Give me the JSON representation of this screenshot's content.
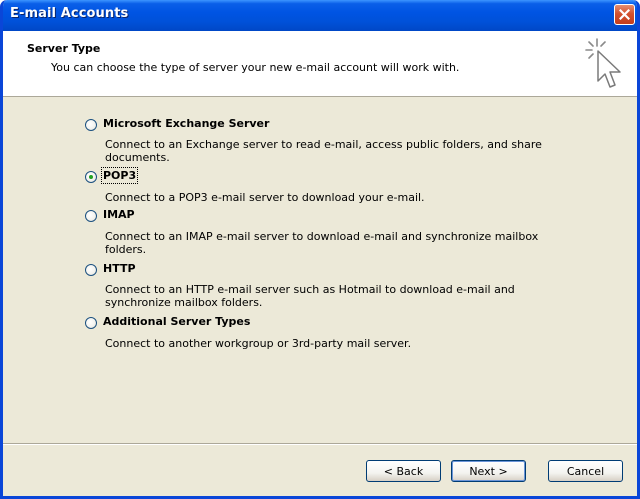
{
  "window": {
    "title": "E-mail Accounts"
  },
  "header": {
    "title": "Server Type",
    "subtitle": "You can choose the type of server your new e-mail account will work with."
  },
  "options": [
    {
      "label": "Microsoft Exchange Server",
      "desc_lines": [
        "Connect to an Exchange server to read e-mail, access public folders, and share",
        "documents."
      ],
      "checked": false
    },
    {
      "label": "POP3",
      "desc_lines": [
        "Connect to a POP3 e-mail server to download your e-mail."
      ],
      "checked": true
    },
    {
      "label": "IMAP",
      "desc_lines": [
        "Connect to an IMAP e-mail server to download e-mail and synchronize mailbox",
        "folders."
      ],
      "checked": false
    },
    {
      "label": "HTTP",
      "desc_lines": [
        "Connect to an HTTP e-mail server such as Hotmail to download e-mail and",
        "synchronize mailbox folders."
      ],
      "checked": false
    },
    {
      "label": "Additional Server Types",
      "desc_lines": [
        "Connect to another workgroup or 3rd-party mail server."
      ],
      "checked": false
    }
  ],
  "footer": {
    "back_label": "< Back",
    "next_label": "Next >",
    "cancel_label": "Cancel"
  },
  "icons": {
    "close": "close-icon",
    "header": "cursor-sparkle-icon"
  }
}
